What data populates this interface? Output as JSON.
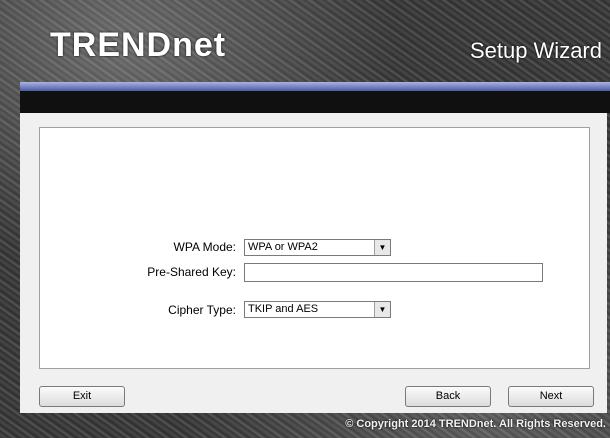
{
  "header": {
    "logo": "TRENDnet",
    "title": "Setup Wizard"
  },
  "form": {
    "wpa_mode_label": "WPA Mode:",
    "wpa_mode_value": "WPA or WPA2",
    "psk_label": "Pre-Shared Key:",
    "psk_value": "",
    "cipher_label": "Cipher Type:",
    "cipher_value": "TKIP and AES"
  },
  "buttons": {
    "exit": "Exit",
    "back": "Back",
    "next": "Next"
  },
  "footer": {
    "copyright": "© Copyright 2014 TRENDnet. All Rights Reserved."
  },
  "colors": {
    "accent_bar": "#6f7fc0",
    "panel": "#f0f0f0"
  }
}
